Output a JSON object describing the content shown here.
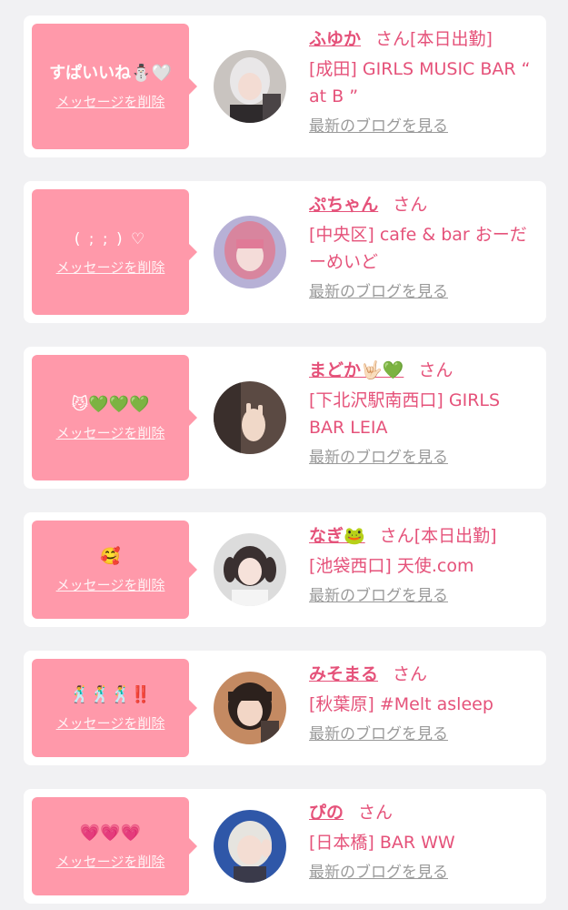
{
  "cards": [
    {
      "message": "すぱいいね⛄🤍",
      "delete_label": "メッセージを削除",
      "name": "ふゆか",
      "suffix": "さん",
      "status": "[本日出勤]",
      "shop": "[成田] GIRLS MUSIC BAR “ at B ”",
      "blog_label": "最新のブログを見る"
    },
    {
      "message": "( ; ; ) ♡",
      "delete_label": "メッセージを削除",
      "name": "ぷちゃん",
      "suffix": "さん",
      "status": "",
      "shop": "[中央区] cafe & bar おーだーめいど",
      "blog_label": "最新のブログを見る"
    },
    {
      "message": "😼💚💚💚",
      "delete_label": "メッセージを削除",
      "name": "まどか🤟🏻💚",
      "suffix": "さん",
      "status": "",
      "shop": "[下北沢駅南西口] GIRLS BAR LEIA",
      "blog_label": "最新のブログを見る"
    },
    {
      "message": "🥰",
      "delete_label": "メッセージを削除",
      "name": "なぎ🐸",
      "suffix": "さん",
      "status": "[本日出勤]",
      "shop": "[池袋西口] 天使.com",
      "blog_label": "最新のブログを見る"
    },
    {
      "message": "🕺🕺🕺‼️",
      "delete_label": "メッセージを削除",
      "name": "みそまる",
      "suffix": "さん",
      "status": "",
      "shop": "[秋葉原] #Melt asleep",
      "blog_label": "最新のブログを見る"
    },
    {
      "message": "💗💗💗",
      "delete_label": "メッセージを削除",
      "name": "ぴの",
      "suffix": "さん",
      "status": "",
      "shop": "[日本橋] BAR WW",
      "blog_label": "最新のブログを見る"
    }
  ],
  "colors": {
    "accent": "#e5527a",
    "bubble": "#ff99aa",
    "page_bg": "#f1f1f3",
    "card_bg": "#ffffff",
    "muted": "#9a9a9a"
  }
}
